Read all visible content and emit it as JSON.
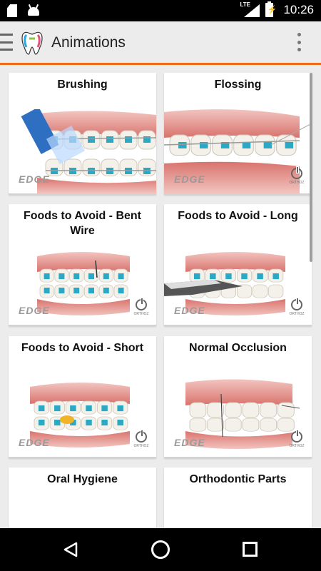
{
  "status_bar": {
    "time": "10:26",
    "network": "LTE",
    "icons": [
      "sd-card-icon",
      "android-icon",
      "signal-icon",
      "battery-charging-icon"
    ]
  },
  "app_bar": {
    "title": "Animations",
    "accent_color": "#ef6c1a",
    "icons": [
      "hamburger-menu-icon",
      "tooth-logo-icon",
      "overflow-menu-icon"
    ]
  },
  "animations": [
    {
      "title": "Brushing",
      "watermark": "EDGE"
    },
    {
      "title": "Flossing",
      "watermark": "EDGE"
    },
    {
      "title": "Foods to Avoid - Bent Wire",
      "watermark": "EDGE"
    },
    {
      "title": "Foods to Avoid - Long",
      "watermark": "EDGE"
    },
    {
      "title": "Foods to Avoid - Short",
      "watermark": "EDGE"
    },
    {
      "title": "Normal Occlusion",
      "watermark": "EDGE"
    },
    {
      "title": "Oral Hygiene",
      "watermark": ""
    },
    {
      "title": "Orthodontic Parts",
      "watermark": ""
    }
  ],
  "brand_badge": "ORTHOZ",
  "colors": {
    "bracket_teal": "#2aa8c4",
    "gum_pink": "#e8958f"
  },
  "nav_bar": {
    "icons": [
      "back-icon",
      "home-icon",
      "recent-apps-icon"
    ]
  }
}
